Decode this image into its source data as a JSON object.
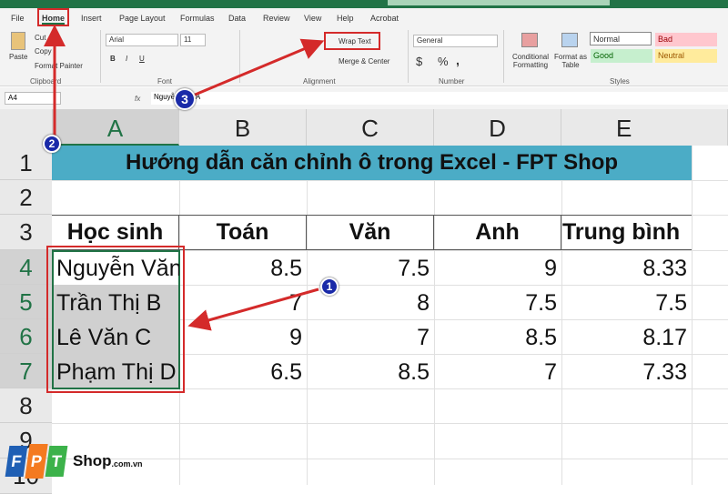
{
  "ribbon_tabs": [
    "File",
    "Home",
    "Insert",
    "Page Layout",
    "Formulas",
    "Data",
    "Review",
    "View",
    "Help",
    "Acrobat"
  ],
  "clipboard": {
    "paste": "Paste",
    "cut": "Cut",
    "copy": "Copy",
    "format_painter": "Format Painter",
    "label": "Clipboard"
  },
  "font": {
    "name": "Arial",
    "size": "11",
    "label": "Font",
    "bold": "B",
    "italic": "I",
    "underline": "U"
  },
  "alignment": {
    "wrap_text": "Wrap Text",
    "merge_center": "Merge & Center",
    "label": "Alignment"
  },
  "number": {
    "format": "General",
    "currency": "$",
    "percent": "%",
    "comma": ",",
    "label": "Number"
  },
  "styles": {
    "conditional": "Conditional Formatting",
    "format_table": "Format as Table",
    "normal": "Normal",
    "bad": "Bad",
    "good": "Good",
    "neutral": "Neutral",
    "label": "Styles"
  },
  "formula_bar": {
    "name_box": "A4",
    "fx": "fx",
    "content": "Nguyễn Văn A"
  },
  "columns": [
    "A",
    "B",
    "C",
    "D",
    "E"
  ],
  "rows": [
    "1",
    "2",
    "3",
    "4",
    "5",
    "6",
    "7",
    "8",
    "9",
    "10"
  ],
  "sheet": {
    "title": "Hướng dẫn căn chỉnh ô trong Excel - FPT Shop",
    "headers": [
      "Học sinh",
      "Toán",
      "Văn",
      "Anh",
      "Trung bình"
    ],
    "data": [
      [
        "Nguyễn Văn A",
        "8.5",
        "7.5",
        "9",
        "8.33"
      ],
      [
        "Trần Thị B",
        "7",
        "8",
        "7.5",
        "7.5"
      ],
      [
        "Lê Văn C",
        "9",
        "7",
        "8.5",
        "8.17"
      ],
      [
        "Phạm Thị D",
        "6.5",
        "8.5",
        "7",
        "7.33"
      ]
    ]
  },
  "markers": [
    "1",
    "2",
    "3"
  ],
  "logo": {
    "brand": "FPT",
    "text": "Shop",
    ".suffix": ".com.vn"
  },
  "colors": {
    "excel_green": "#217346",
    "title_fill": "#4bacc6",
    "selection": "#d0d0d0",
    "annotation_red": "#d42a2a"
  }
}
